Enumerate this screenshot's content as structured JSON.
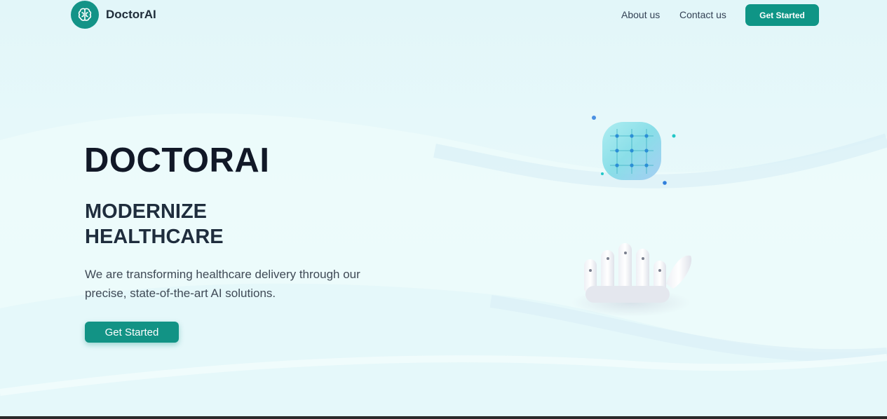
{
  "header": {
    "brand": "DoctorAI",
    "nav": {
      "about": "About us",
      "contact": "Contact us"
    },
    "cta_label": "Get Started"
  },
  "hero": {
    "title": "DOCTORAI",
    "subtitle": "MODERNIZE HEALTHCARE",
    "description": "We are transforming healthcare delivery through our precise, state-of-the-art AI solutions.",
    "cta_label": "Get Started"
  },
  "icons": {
    "logo": "brain-icon",
    "illustration_chip": "circuit-grid-icon",
    "illustration_hand": "robot-hand-icon"
  },
  "colors": {
    "brand": "#139387",
    "button": "#0f9586",
    "text_dark": "#111827",
    "background": "#e6f8fa"
  }
}
